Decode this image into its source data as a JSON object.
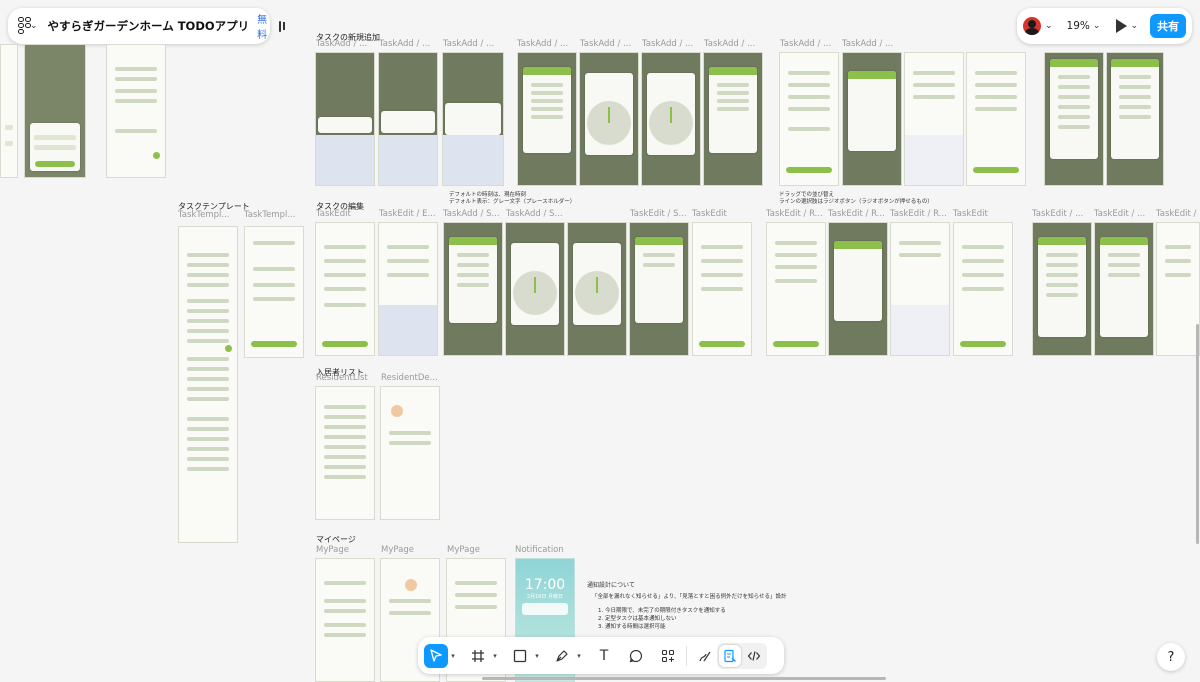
{
  "file": {
    "name": "やすらぎガーデンホーム TODOアプリ",
    "plan": "無料",
    "menu_caret": "⌄"
  },
  "topbar": {
    "zoom": "19%",
    "share_label": "共有"
  },
  "sections": {
    "task_add": "タスクの新規追加",
    "task_template": "タスクテンプレート",
    "task_edit": "タスクの編集",
    "resident_list": "入居者リスト",
    "my_page": "マイページ"
  },
  "frame_labels": {
    "task_add": [
      "TaskAdd / ...",
      "TaskAdd / ...",
      "TaskAdd / ...",
      "TaskAdd / ...",
      "TaskAdd / ...",
      "TaskAdd / ...",
      "TaskAdd / ...",
      "TaskAdd / ...",
      "TaskAdd / ..."
    ],
    "task_template": [
      "TaskTempl...",
      "TaskTempl..."
    ],
    "task_edit": [
      "TaskEdit",
      "TaskEdit / E...",
      "TaskAdd / S...",
      "TaskEdit / S...",
      "TaskEdit",
      "TaskEdit / R...",
      "TaskEdit / R...",
      "TaskEdit / R...",
      "TaskEdit",
      "TaskEdit / ...",
      "TaskEdit / ...",
      "TaskEdit / ..."
    ],
    "resident": [
      "ResidentList",
      "ResidentDe..."
    ],
    "my_page": [
      "MyPage",
      "MyPage",
      "MyPage",
      "Notification"
    ]
  },
  "canvas_notes": {
    "task_add_caption": "デフォルトの時刻は、現在時刻",
    "task_add_caption_2": "デフォルト表示：グレー文字（プレースホルダー）",
    "task_edit_caption": "ドラッグでの並び替え",
    "task_edit_caption_2": "ラインの選択肢はラジオボタン（ラジオボタンが押せるもの）"
  },
  "notification_frame": {
    "time": "17:00",
    "date": "2月16日 月曜日"
  },
  "notification_notes": {
    "title": "通知設計について",
    "quote": "「全部を漏れなく知らせる」より、「見落とすと困る例外だけを知らせる」設計",
    "items": [
      "1. 今日期限で、未完了の期限付きタスクを通知する",
      "2. 定型タスクは基本通知しない",
      "3. 通知する時間は選択可能"
    ]
  },
  "toolbar": {
    "tools": [
      "move-tool",
      "frame-tool",
      "shape-tool",
      "pen-tool",
      "text-tool",
      "comment-tool",
      "actions-tool"
    ],
    "text_tool_glyph": "T",
    "help_glyph": "?"
  },
  "colors": {
    "accent_blue": "#0d99ff",
    "app_green": "#8cc04b",
    "canvas_bg": "#f5f5f5"
  }
}
